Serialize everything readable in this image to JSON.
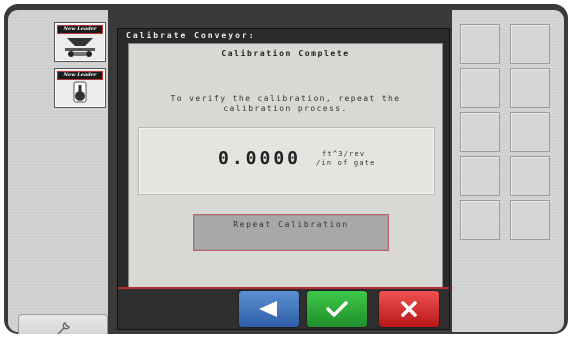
{
  "app_buttons": [
    {
      "label": "New Leader"
    },
    {
      "label": "New Leader"
    }
  ],
  "dialog": {
    "title": "Calibrate Conveyor:",
    "status": "Calibration Complete",
    "instructions_line1": "To verify the calibration, repeat the",
    "instructions_line2": "calibration process.",
    "value": "0.0000",
    "units_line1": "ft^3/rev",
    "units_line2": "/in of gate",
    "repeat_button_label": "Repeat Calibration"
  },
  "footer": {
    "back_icon": "arrow-left-icon",
    "ok_icon": "checkmark-icon",
    "cancel_icon": "x-icon"
  },
  "colors": {
    "back": "#3f73b8",
    "ok": "#2aa835",
    "cancel": "#d42828",
    "accent_border": "#b23030"
  }
}
